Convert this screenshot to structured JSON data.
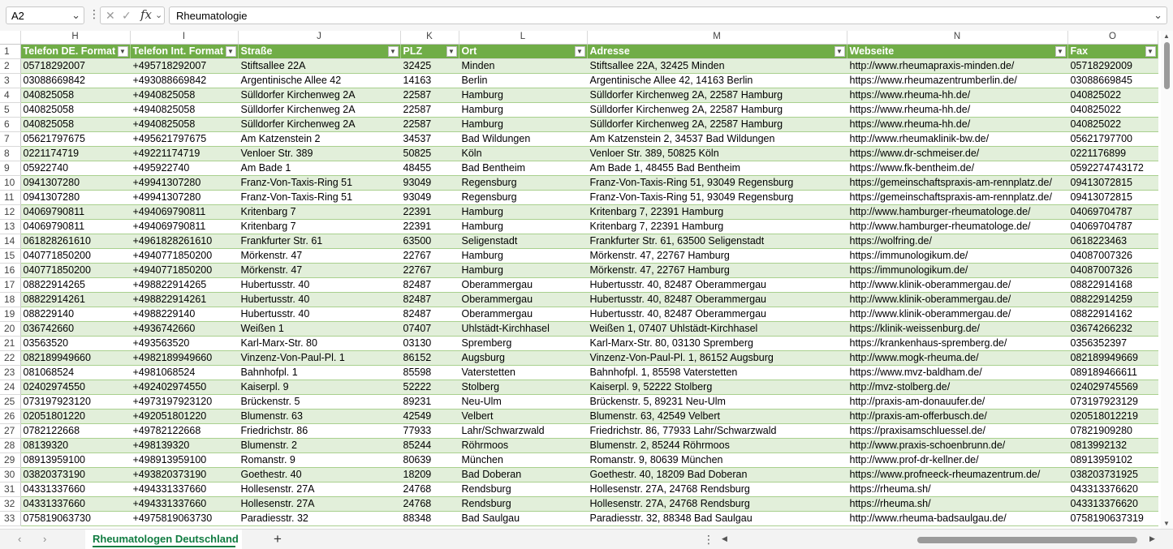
{
  "formula_bar": {
    "name_box": "A2",
    "cancel_icon": "cancel-icon",
    "enter_icon": "check-icon",
    "fx_label": "fx",
    "formula": "Rheumatologie"
  },
  "columns": [
    "H",
    "I",
    "J",
    "K",
    "L",
    "M",
    "N",
    "O"
  ],
  "headers": [
    "Telefon DE. Format",
    "Telefon Int. Format",
    "Straße",
    "PLZ",
    "Ort",
    "Adresse",
    "Webseite",
    "Fax"
  ],
  "rows": [
    [
      "05718292007",
      "+495718292007",
      "Stiftsallee 22A",
      "32425",
      "Minden",
      "Stiftsallee 22A, 32425 Minden",
      "http://www.rheumapraxis-minden.de/",
      "05718292009"
    ],
    [
      "03088669842",
      "+493088669842",
      "Argentinische Allee 42",
      "14163",
      "Berlin",
      "Argentinische Allee 42, 14163 Berlin",
      "https://www.rheumazentrumberlin.de/",
      "03088669845"
    ],
    [
      "040825058",
      "+4940825058",
      "Sülldorfer Kirchenweg 2A",
      "22587",
      "Hamburg",
      "Sülldorfer Kirchenweg 2A, 22587 Hamburg",
      "https://www.rheuma-hh.de/",
      "040825022"
    ],
    [
      "040825058",
      "+4940825058",
      "Sülldorfer Kirchenweg 2A",
      "22587",
      "Hamburg",
      "Sülldorfer Kirchenweg 2A, 22587 Hamburg",
      "https://www.rheuma-hh.de/",
      "040825022"
    ],
    [
      "040825058",
      "+4940825058",
      "Sülldorfer Kirchenweg 2A",
      "22587",
      "Hamburg",
      "Sülldorfer Kirchenweg 2A, 22587 Hamburg",
      "https://www.rheuma-hh.de/",
      "040825022"
    ],
    [
      "05621797675",
      "+495621797675",
      "Am Katzenstein 2",
      "34537",
      "Bad Wildungen",
      "Am Katzenstein 2, 34537 Bad Wildungen",
      "http://www.rheumaklinik-bw.de/",
      "05621797700"
    ],
    [
      "0221174719",
      "+49221174719",
      "Venloer Str. 389",
      "50825",
      "Köln",
      "Venloer Str. 389, 50825 Köln",
      "https://www.dr-schmeiser.de/",
      "0221176899"
    ],
    [
      "05922740",
      "+495922740",
      "Am Bade 1",
      "48455",
      "Bad Bentheim",
      "Am Bade 1, 48455 Bad Bentheim",
      "https://www.fk-bentheim.de/",
      "0592274743172"
    ],
    [
      "0941307280",
      "+49941307280",
      "Franz-Von-Taxis-Ring 51",
      "93049",
      "Regensburg",
      "Franz-Von-Taxis-Ring 51, 93049 Regensburg",
      "https://gemeinschaftspraxis-am-rennplatz.de/",
      "09413072815"
    ],
    [
      "0941307280",
      "+49941307280",
      "Franz-Von-Taxis-Ring 51",
      "93049",
      "Regensburg",
      "Franz-Von-Taxis-Ring 51, 93049 Regensburg",
      "https://gemeinschaftspraxis-am-rennplatz.de/",
      "09413072815"
    ],
    [
      "04069790811",
      "+494069790811",
      "Kritenbarg 7",
      "22391",
      "Hamburg",
      "Kritenbarg 7, 22391 Hamburg",
      "http://www.hamburger-rheumatologe.de/",
      "04069704787"
    ],
    [
      "04069790811",
      "+494069790811",
      "Kritenbarg 7",
      "22391",
      "Hamburg",
      "Kritenbarg 7, 22391 Hamburg",
      "http://www.hamburger-rheumatologe.de/",
      "04069704787"
    ],
    [
      "061828261610",
      "+4961828261610",
      "Frankfurter Str. 61",
      "63500",
      "Seligenstadt",
      "Frankfurter Str. 61, 63500 Seligenstadt",
      "https://wolfring.de/",
      "0618223463"
    ],
    [
      "040771850200",
      "+4940771850200",
      "Mörkenstr. 47",
      "22767",
      "Hamburg",
      "Mörkenstr. 47, 22767 Hamburg",
      "https://immunologikum.de/",
      "04087007326"
    ],
    [
      "040771850200",
      "+4940771850200",
      "Mörkenstr. 47",
      "22767",
      "Hamburg",
      "Mörkenstr. 47, 22767 Hamburg",
      "https://immunologikum.de/",
      "04087007326"
    ],
    [
      "08822914265",
      "+498822914265",
      "Hubertusstr. 40",
      "82487",
      "Oberammergau",
      "Hubertusstr. 40, 82487 Oberammergau",
      "http://www.klinik-oberammergau.de/",
      "08822914168"
    ],
    [
      "08822914261",
      "+498822914261",
      "Hubertusstr. 40",
      "82487",
      "Oberammergau",
      "Hubertusstr. 40, 82487 Oberammergau",
      "http://www.klinik-oberammergau.de/",
      "08822914259"
    ],
    [
      "088229140",
      "+4988229140",
      "Hubertusstr. 40",
      "82487",
      "Oberammergau",
      "Hubertusstr. 40, 82487 Oberammergau",
      "http://www.klinik-oberammergau.de/",
      "08822914162"
    ],
    [
      "036742660",
      "+4936742660",
      "Weißen 1",
      "07407",
      "Uhlstädt-Kirchhasel",
      "Weißen 1, 07407 Uhlstädt-Kirchhasel",
      "https://klinik-weissenburg.de/",
      "03674266232"
    ],
    [
      "03563520",
      "+493563520",
      "Karl-Marx-Str. 80",
      "03130",
      "Spremberg",
      "Karl-Marx-Str. 80, 03130 Spremberg",
      "https://krankenhaus-spremberg.de/",
      "0356352397"
    ],
    [
      "082189949660",
      "+4982189949660",
      "Vinzenz-Von-Paul-Pl. 1",
      "86152",
      "Augsburg",
      "Vinzenz-Von-Paul-Pl. 1, 86152 Augsburg",
      "http://www.mogk-rheuma.de/",
      "082189949669"
    ],
    [
      "081068524",
      "+4981068524",
      "Bahnhofpl. 1",
      "85598",
      "Vaterstetten",
      "Bahnhofpl. 1, 85598 Vaterstetten",
      "https://www.mvz-baldham.de/",
      "089189466611"
    ],
    [
      "02402974550",
      "+492402974550",
      "Kaiserpl. 9",
      "52222",
      "Stolberg",
      "Kaiserpl. 9, 52222 Stolberg",
      "http://mvz-stolberg.de/",
      "024029745569"
    ],
    [
      "073197923120",
      "+4973197923120",
      "Brückenstr. 5",
      "89231",
      "Neu-Ulm",
      "Brückenstr. 5, 89231 Neu-Ulm",
      "http://praxis-am-donauufer.de/",
      "073197923129"
    ],
    [
      "02051801220",
      "+492051801220",
      "Blumenstr. 63",
      "42549",
      "Velbert",
      "Blumenstr. 63, 42549 Velbert",
      "http://praxis-am-offerbusch.de/",
      "020518012219"
    ],
    [
      "0782122668",
      "+49782122668",
      "Friedrichstr. 86",
      "77933",
      "Lahr/Schwarzwald",
      "Friedrichstr. 86, 77933 Lahr/Schwarzwald",
      "https://praxisamschluessel.de/",
      "07821909280"
    ],
    [
      "08139320",
      "+498139320",
      "Blumenstr. 2",
      "85244",
      "Röhrmoos",
      "Blumenstr. 2, 85244 Röhrmoos",
      "http://www.praxis-schoenbrunn.de/",
      "0813992132"
    ],
    [
      "08913959100",
      "+498913959100",
      "Romanstr. 9",
      "80639",
      "München",
      "Romanstr. 9, 80639 München",
      "http://www.prof-dr-kellner.de/",
      "08913959102"
    ],
    [
      "03820373190",
      "+493820373190",
      "Goethestr. 40",
      "18209",
      "Bad Doberan",
      "Goethestr. 40, 18209 Bad Doberan",
      "https://www.profneeck-rheumazentrum.de/",
      "038203731925"
    ],
    [
      "04331337660",
      "+494331337660",
      "Hollesenstr. 27A",
      "24768",
      "Rendsburg",
      "Hollesenstr. 27A, 24768 Rendsburg",
      "https://rheuma.sh/",
      "043313376620"
    ],
    [
      "04331337660",
      "+494331337660",
      "Hollesenstr. 27A",
      "24768",
      "Rendsburg",
      "Hollesenstr. 27A, 24768 Rendsburg",
      "https://rheuma.sh/",
      "043313376620"
    ],
    [
      "075819063730",
      "+4975819063730",
      "Paradiesstr. 32",
      "88348",
      "Bad Saulgau",
      "Paradiesstr. 32, 88348 Bad Saulgau",
      "http://www.rheuma-badsaulgau.de/",
      "0758190637319"
    ]
  ],
  "sheet_bar": {
    "prev_icon": "chevron-left-icon",
    "next_icon": "chevron-right-icon",
    "active_sheet": "Rheumatologen Deutschland",
    "add_sheet_label": "+"
  },
  "colors": {
    "header_bg": "#70ad47",
    "band_bg": "#e2efda",
    "accent": "#107c41"
  }
}
